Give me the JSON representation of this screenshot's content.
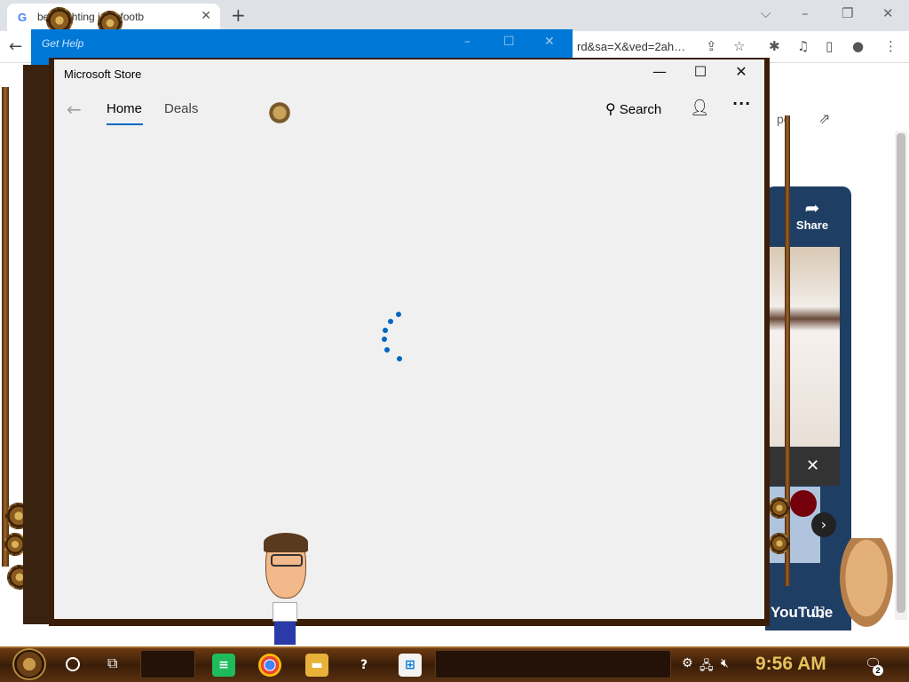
{
  "browser": {
    "tab_title": "best fighting irish footb",
    "tab_close": "✕",
    "new_tab": "+",
    "url_fragment": "rd&sa=X&ved=2ah…",
    "window_controls": [
      "⌵",
      "–",
      "❐",
      "✕"
    ]
  },
  "youtube": {
    "share_label": "Share",
    "brand": "YouTube",
    "external_label": "pe",
    "close": "✕",
    "next": "›"
  },
  "help_window": {
    "title": "Get Help"
  },
  "store": {
    "title": "Microsoft Store",
    "nav": {
      "back": "←",
      "home": "Home",
      "deals": "Deals"
    },
    "search_label": "Search",
    "account_icon": "person-add-icon",
    "more": "···",
    "controls": {
      "minimize": "—",
      "maximize": "☐",
      "close": "✕"
    },
    "accent": "#0067c0"
  },
  "taskbar": {
    "clock": "9:56 AM",
    "notification_count": "2"
  }
}
